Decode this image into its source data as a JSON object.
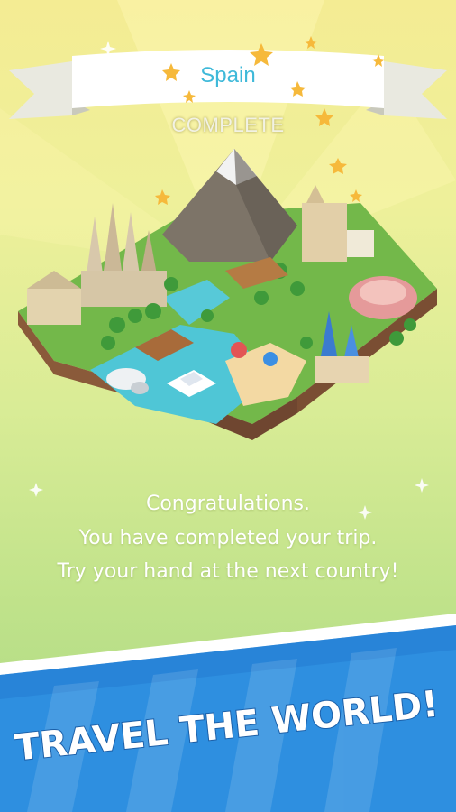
{
  "ribbon": {
    "country": "Spain",
    "status": "COMPLETE"
  },
  "message": {
    "line1": "Congratulations.",
    "line2": "You have completed your trip.",
    "line3": "Try your hand at the next country!"
  },
  "banner": {
    "headline": "TRAVEL THE WORLD!"
  },
  "colors": {
    "bg_top": "#f4ec93",
    "bg_bottom": "#a8d783",
    "banner_blue": "#2e8fe0",
    "country_text": "#3fb9d9"
  },
  "icons": [
    "star-icon",
    "sparkle-icon"
  ]
}
